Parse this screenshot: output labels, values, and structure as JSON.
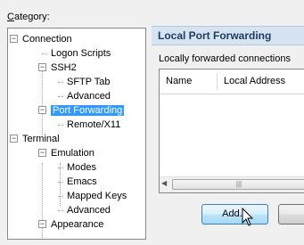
{
  "category": {
    "label": "Category:",
    "underline": "C",
    "rest": "ategory:"
  },
  "tree": {
    "items": [
      {
        "label": "Connection",
        "level": 0,
        "expanded": true
      },
      {
        "label": "Logon Scripts",
        "level": 1
      },
      {
        "label": "SSH2",
        "level": 1,
        "expanded": true
      },
      {
        "label": "SFTP Tab",
        "level": 2
      },
      {
        "label": "Advanced",
        "level": 2
      },
      {
        "label": "Port Forwarding",
        "level": 1,
        "expanded": true,
        "selected": true
      },
      {
        "label": "Remote/X11",
        "level": 2
      },
      {
        "label": "Terminal",
        "level": 0,
        "expanded": true
      },
      {
        "label": "Emulation",
        "level": 1,
        "expanded": true
      },
      {
        "label": "Modes",
        "level": 2
      },
      {
        "label": "Emacs",
        "level": 2
      },
      {
        "label": "Mapped Keys",
        "level": 2
      },
      {
        "label": "Advanced",
        "level": 2
      },
      {
        "label": "Appearance",
        "level": 1,
        "expanded": true
      }
    ]
  },
  "panel": {
    "title": "Local Port Forwarding",
    "list_label": "Locally forwarded connections",
    "columns": [
      "Name",
      "Local Address"
    ],
    "scroll_grip": "|||"
  },
  "buttons": {
    "add": "Add..."
  },
  "colors": {
    "header_bg": "#d6e3f3",
    "header_text": "#1e3b5e",
    "selection": "#3399ff"
  }
}
